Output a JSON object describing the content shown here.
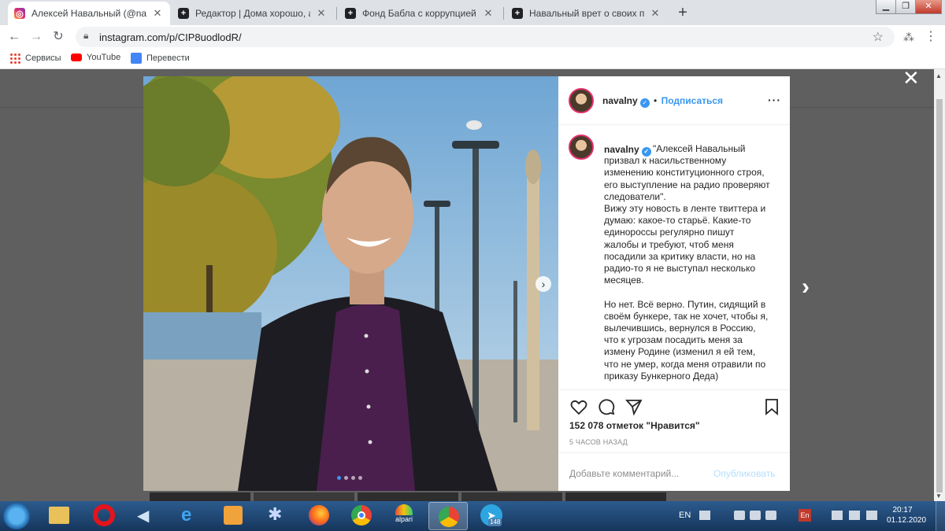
{
  "tabs": [
    {
      "title": "Алексей Навальный (@navalny)",
      "icon": "instagram-icon",
      "active": true
    },
    {
      "title": "Редактор | Дома хорошо, а в Ге",
      "icon": "plus-square-icon",
      "active": false
    },
    {
      "title": "Фонд Бабла с коррупцией | Янд",
      "icon": "plus-square-icon",
      "active": false
    },
    {
      "title": "Навальный врет о своих планах",
      "icon": "plus-square-icon",
      "active": false
    }
  ],
  "address_bar": {
    "url": "instagram.com/p/CIP8uodlodR/"
  },
  "bookmarks": [
    {
      "label": "Сервисы",
      "icon": "apps-grid-icon"
    },
    {
      "label": "YouTube",
      "icon": "youtube-icon"
    },
    {
      "label": "Перевести",
      "icon": "translate-icon"
    }
  ],
  "post": {
    "username": "navalny",
    "follow_label": "Подписаться",
    "dot": "•",
    "caption": "\"Алексей Навальный призвал к насильственному изменению конституционного строя, его выступление на радио проверяют следователи\".\nВижу эту новость в ленте твиттера и думаю: какое-то старьё. Какие-то единороссы регулярно пишут жалобы и требуют, чтоб меня посадили за критику власти, но на радио-то я не выступал несколько месяцев.\n\nНо нет. Всё верно. Путин, сидящий в своём бункере, так не хочет, чтобы я, вылечившись, вернулся в Россию, что к угрозам посадить меня за измену Родине (изменил я ей тем, что не умер, когда меня отравили по приказу Бункерного Деда)",
    "likes": "152 078 отметок \"Нравится\"",
    "time_ago": "5 ЧАСОВ НАЗАД",
    "comment_placeholder": "Добавьте комментарий...",
    "publish_label": "Опубликовать",
    "carousel_dots": 4,
    "carousel_active": 0
  },
  "taskbar": {
    "lang": "EN",
    "clock_time": "20:17",
    "clock_date": "01.12.2020",
    "telegram_badge": "148",
    "alpari_label": "alpari",
    "kbd_label": "En",
    "apps": [
      "start-orb-icon",
      "file-explorer-icon",
      "opera-icon",
      "volume-icon",
      "ie-icon",
      "media-player-icon",
      "spider-icon",
      "firefox-icon",
      "chrome-icon",
      "alpari-icon",
      "chrome-active-icon",
      "telegram-icon"
    ]
  },
  "colors": {
    "instagram_blue": "#3897f0",
    "verified_blue": "#3897f0",
    "tab_strip": "#dee1e6",
    "taskbar": "#1f4a7a"
  }
}
